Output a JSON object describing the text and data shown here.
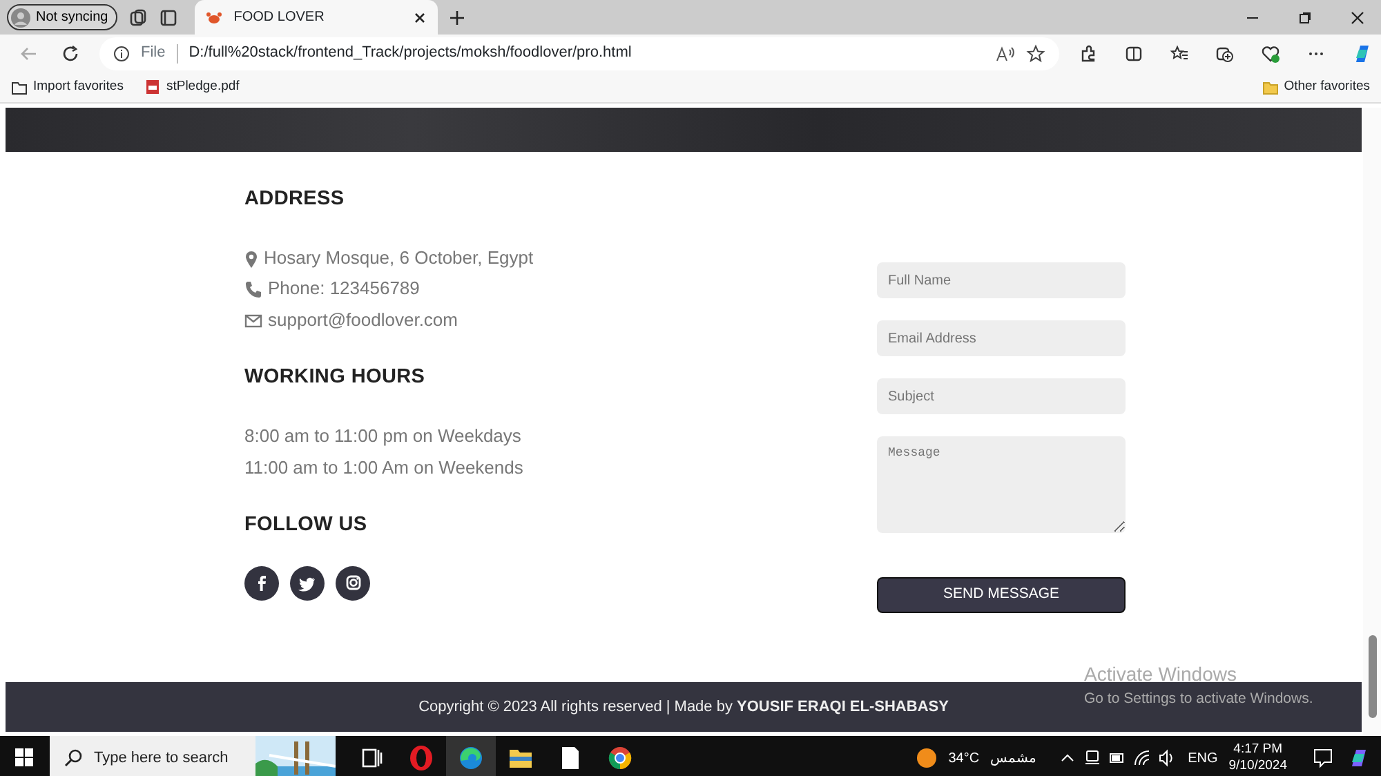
{
  "browser": {
    "profile": "Not syncing",
    "tabs": [
      {
        "title": "FOOD LOVER",
        "selected": true
      }
    ],
    "address": {
      "scheme": "File",
      "url": "D:/full%20stack/frontend_Track/projects/moksh/foodlover/pro.html"
    },
    "favorites": [
      {
        "kind": "import",
        "label": "Import favorites"
      },
      {
        "kind": "pdf",
        "label": "stPledge.pdf"
      }
    ],
    "other_favorites": "Other favorites"
  },
  "page": {
    "address": {
      "heading": "ADDRESS",
      "lines": [
        {
          "kind": "location",
          "text": "Hosary Mosque, 6 October, Egypt"
        },
        {
          "kind": "phone",
          "text": "Phone: 123456789"
        },
        {
          "kind": "email",
          "text": "support@foodlover.com"
        }
      ]
    },
    "hours": {
      "heading": "WORKING HOURS",
      "lines": [
        "8:00 am to 11:00 pm on Weekdays",
        "11:00 am to 1:00 Am on Weekends"
      ]
    },
    "follow": {
      "heading": "FOLLOW US",
      "links": [
        {
          "kind": "facebook"
        },
        {
          "kind": "twitter"
        },
        {
          "kind": "instagram"
        }
      ]
    },
    "form": {
      "fields": [
        {
          "kind": "input",
          "placeholder": "Full Name"
        },
        {
          "kind": "input",
          "placeholder": "Email Address"
        },
        {
          "kind": "input",
          "placeholder": "Subject"
        },
        {
          "kind": "textarea",
          "placeholder": "Message"
        }
      ],
      "button": "SEND MESSAGE"
    },
    "footer": "Copyright © 2023 All rights reserved | Made by **YOUSIF ERAQI EL-SHABASY**"
  },
  "activation": {
    "title": "Activate Windows",
    "subtitle": "Go to Settings to activate Windows."
  },
  "taskbar": {
    "search": {
      "placeholder": "Type here to search"
    },
    "apps": [
      {
        "kind": "taskview",
        "active": false
      },
      {
        "kind": "opera",
        "active": false
      },
      {
        "kind": "edge",
        "active": true
      },
      {
        "kind": "folder",
        "active": false
      },
      {
        "kind": "file",
        "active": false
      },
      {
        "kind": "chrome",
        "active": false
      }
    ],
    "weather": {
      "temp": "34°C",
      "label": "مشمس"
    },
    "language": "ENG",
    "time": "4:17 PM",
    "date": "9/10/2024"
  }
}
